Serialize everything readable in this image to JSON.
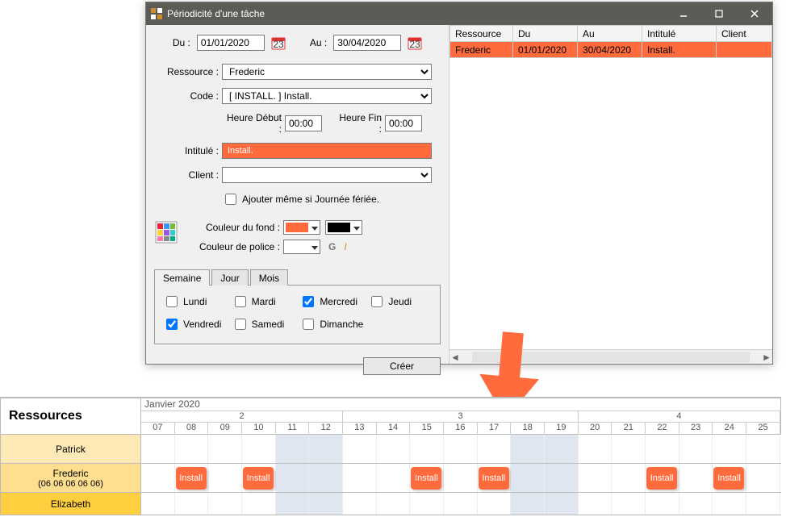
{
  "window": {
    "title": "Périodicité d'une tâche",
    "date_from_label": "Du :",
    "date_from": "01/01/2020",
    "date_to_label": "Au :",
    "date_to": "30/04/2020",
    "resource_label": "Ressource :",
    "resource_value": "Frederic",
    "code_label": "Code :",
    "code_value": "[ INSTALL. ] Install.",
    "heure_debut_label": "Heure Début :",
    "heure_debut": "00:00",
    "heure_fin_label": "Heure Fin :",
    "heure_fin": "00:00",
    "intitule_label": "Intitulé :",
    "intitule_value": "Install.",
    "client_label": "Client :",
    "client_value": "",
    "holiday_checkbox": "Ajouter même si Journée fériée.",
    "bg_color_label": "Couleur du fond :",
    "bg_color": "#ff6b3d",
    "fg_color_label": "Couleur de police :",
    "fg_color": "#ffffff",
    "fg_color_sample": "#000000",
    "bold_label": "G",
    "italic_label": "I",
    "tabs": {
      "semaine": "Semaine",
      "jour": "Jour",
      "mois": "Mois"
    },
    "days": {
      "lundi": "Lundi",
      "mardi": "Mardi",
      "mercredi": "Mercredi",
      "jeudi": "Jeudi",
      "vendredi": "Vendredi",
      "samedi": "Samedi",
      "dimanche": "Dimanche"
    },
    "create_button": "Créer"
  },
  "right_table": {
    "headers": {
      "ressource": "Ressource",
      "du": "Du",
      "au": "Au",
      "intitule": "Intitulé",
      "client": "Client"
    },
    "row": {
      "ressource": "Frederic",
      "du": "01/01/2020",
      "au": "30/04/2020",
      "intitule": "Install.",
      "client": ""
    }
  },
  "planner": {
    "header": "Ressources",
    "month": "Janvier 2020",
    "weeks": [
      "2",
      "3",
      "4"
    ],
    "days": [
      "07",
      "08",
      "09",
      "10",
      "11",
      "12",
      "13",
      "14",
      "15",
      "16",
      "17",
      "18",
      "19",
      "20",
      "21",
      "22",
      "23",
      "24",
      "25"
    ],
    "resources": {
      "patrick": "Patrick",
      "frederic_name": "Frederic",
      "frederic_phone": "(06 06 06 06 06)",
      "elizabeth": "Elizabeth"
    },
    "task_label": "Install",
    "weekend_indices": [
      4,
      5,
      11,
      12
    ],
    "task_day_indices": [
      1,
      3,
      8,
      10,
      15,
      17
    ]
  }
}
